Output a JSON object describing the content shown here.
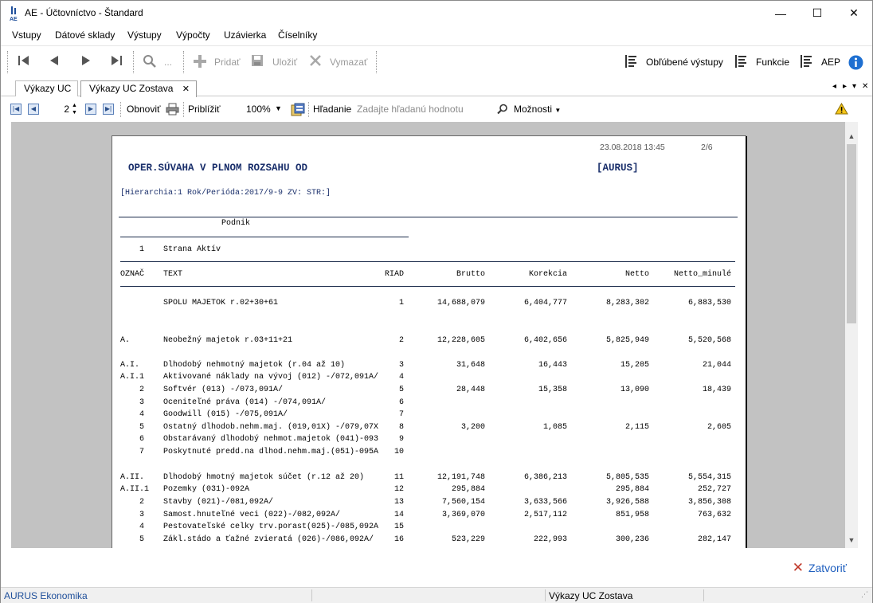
{
  "window": {
    "logo_text": "AE",
    "title": "AE - Účtovníctvo - Štandard",
    "minimize": "—",
    "maximize": "☐",
    "close": "✕"
  },
  "menu": [
    "Vstupy",
    "Dátové sklady",
    "Výstupy",
    "Výpočty",
    "Uzávierka",
    "Číselníky"
  ],
  "toolbar": {
    "search_dots": "...",
    "add_label": "Pridať",
    "save_label": "Uložiť",
    "delete_label": "Vymazať",
    "favorites_label": "Obľúbené výstupy",
    "functions_label": "Funkcie",
    "aep_label": "AEP"
  },
  "tabs": [
    {
      "label": "Výkazy UC",
      "closable": false
    },
    {
      "label": "Výkazy UC Zostava",
      "closable": true
    }
  ],
  "tab_nav": {
    "left": "◂",
    "right": "▸",
    "down": "▾",
    "close": "✕"
  },
  "report_toolbar": {
    "page_number": "2",
    "refresh_label": "Obnoviť",
    "zoom_label": "Priblížiť",
    "zoom_value": "100%",
    "search_label": "Hľadanie",
    "search_placeholder": "Zadajte hľadanú hodnotu",
    "options_label": "Možnosti"
  },
  "report": {
    "timestamp": "23.08.2018 13:45",
    "page": "2/6",
    "title": "OPER.SÚVAHA V PLNOM ROZSAHU OD",
    "company": "[AURUS]",
    "hierarchy": "[Hierarchia:1 Rok/Perióda:2017/9-9 ZV: STR:]",
    "group_label": "Podnik",
    "side_number": "1",
    "side_label": "Strana Aktív",
    "columns": {
      "oznac": "OZNAČ",
      "text": "TEXT",
      "riad": "RIAD",
      "brutto": "Brutto",
      "korekcia": "Korekcia",
      "netto": "Netto",
      "netto_minule": "Netto_minulé"
    },
    "rows": [
      {
        "oznac": "",
        "text": "SPOLU MAJETOK r.02+30+61",
        "riad": "1",
        "brutto": "14,688,079",
        "korekcia": "6,404,777",
        "netto": "8,283,302",
        "netto_minule": "6,883,530"
      },
      {
        "oznac": "A.",
        "text": "Neobežný majetok r.03+11+21",
        "riad": "2",
        "brutto": "12,228,605",
        "korekcia": "6,402,656",
        "netto": "5,825,949",
        "netto_minule": "5,520,568"
      },
      {
        "oznac": "A.I.",
        "text": "Dlhodobý nehmotný majetok (r.04 až 10)",
        "riad": "3",
        "brutto": "31,648",
        "korekcia": "16,443",
        "netto": "15,205",
        "netto_minule": "21,044"
      },
      {
        "oznac": "A.I.1",
        "text": "Aktivované náklady na vývoj (012) -/072,091A/",
        "riad": "4",
        "brutto": "",
        "korekcia": "",
        "netto": "",
        "netto_minule": ""
      },
      {
        "oznac": "2",
        "text": "Softvér (013) -/073,091A/",
        "riad": "5",
        "brutto": "28,448",
        "korekcia": "15,358",
        "netto": "13,090",
        "netto_minule": "18,439"
      },
      {
        "oznac": "3",
        "text": "Oceniteľné práva (014) -/074,091A/",
        "riad": "6",
        "brutto": "",
        "korekcia": "",
        "netto": "",
        "netto_minule": ""
      },
      {
        "oznac": "4",
        "text": "Goodwill (015) -/075,091A/",
        "riad": "7",
        "brutto": "",
        "korekcia": "",
        "netto": "",
        "netto_minule": ""
      },
      {
        "oznac": "5",
        "text": "Ostatný dlhodob.nehm.maj. (019,01X) -/079,07X",
        "riad": "8",
        "brutto": "3,200",
        "korekcia": "1,085",
        "netto": "2,115",
        "netto_minule": "2,605"
      },
      {
        "oznac": "6",
        "text": "Obstarávaný dlhodobý nehmot.majetok (041)-093",
        "riad": "9",
        "brutto": "",
        "korekcia": "",
        "netto": "",
        "netto_minule": ""
      },
      {
        "oznac": "7",
        "text": "Poskytnuté predd.na dlhod.nehm.maj.(051)-095A",
        "riad": "10",
        "brutto": "",
        "korekcia": "",
        "netto": "",
        "netto_minule": ""
      },
      {
        "oznac": "A.II.",
        "text": "Dlhodobý hmotný majetok súčet (r.12 až 20)",
        "riad": "11",
        "brutto": "12,191,748",
        "korekcia": "6,386,213",
        "netto": "5,805,535",
        "netto_minule": "5,554,315"
      },
      {
        "oznac": "A.II.1",
        "text": "Pozemky (031)-092A",
        "riad": "12",
        "brutto": "295,884",
        "korekcia": "",
        "netto": "295,884",
        "netto_minule": "252,727"
      },
      {
        "oznac": "2",
        "text": "Stavby (021)-/081,092A/",
        "riad": "13",
        "brutto": "7,560,154",
        "korekcia": "3,633,566",
        "netto": "3,926,588",
        "netto_minule": "3,856,308"
      },
      {
        "oznac": "3",
        "text": "Samost.hnuteľné veci (022)-/082,092A/",
        "riad": "14",
        "brutto": "3,369,070",
        "korekcia": "2,517,112",
        "netto": "851,958",
        "netto_minule": "763,632"
      },
      {
        "oznac": "4",
        "text": "Pestovateľské celky trv.porast(025)-/085,092A",
        "riad": "15",
        "brutto": "",
        "korekcia": "",
        "netto": "",
        "netto_minule": ""
      },
      {
        "oznac": "5",
        "text": "Zákl.stádo a ťažné zvieratá (026)-/086,092A/",
        "riad": "16",
        "brutto": "523,229",
        "korekcia": "222,993",
        "netto": "300,236",
        "netto_minule": "282,147"
      }
    ]
  },
  "footer": {
    "close_label": "Zatvoriť"
  },
  "statusbar": {
    "left": "AURUS Ekonomika",
    "right": "Výkazy UC Zostava"
  }
}
